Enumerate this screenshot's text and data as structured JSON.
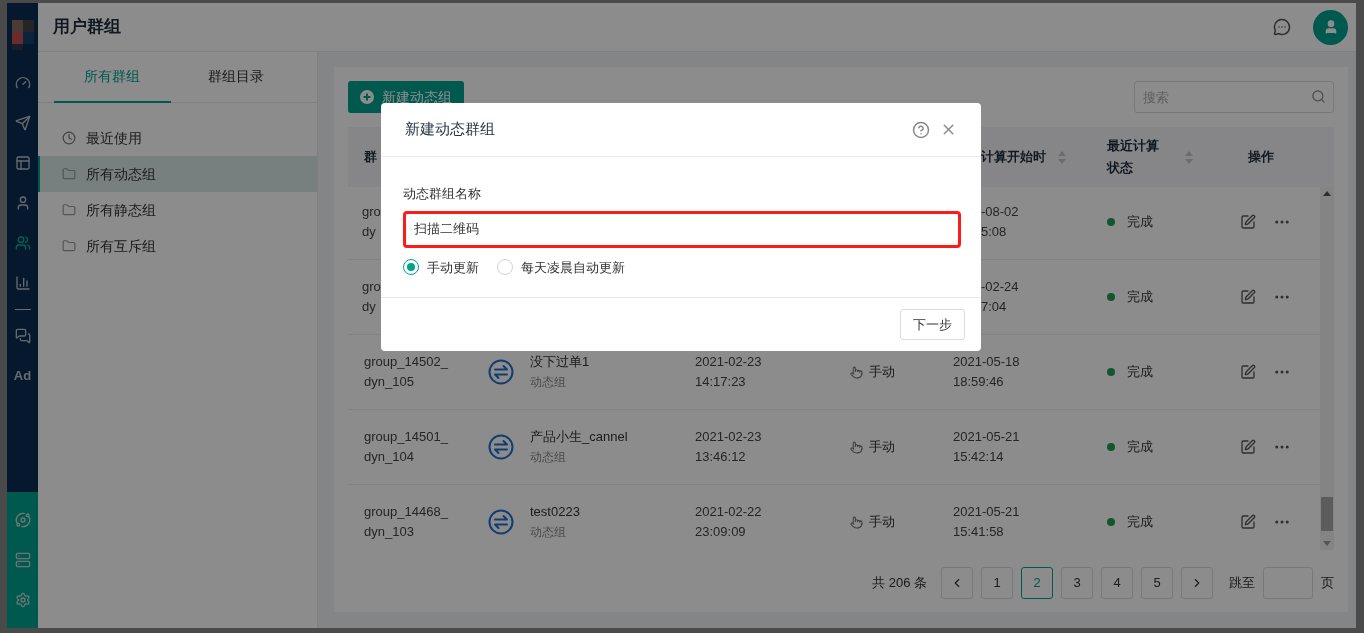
{
  "app_header": {
    "title": "用户群组"
  },
  "sidebar": {
    "nav": [
      {
        "selected": false
      },
      {
        "selected": false
      },
      {
        "selected": false
      },
      {
        "selected": false
      },
      {
        "selected": true
      },
      {
        "selected": false
      },
      {
        "selected": false
      },
      {
        "label": "Ad",
        "selected": false
      }
    ],
    "bottom": [
      {
        "selected": false
      },
      {
        "selected": false
      },
      {
        "selected": false
      }
    ]
  },
  "left_panel": {
    "tabs": [
      {
        "label": "所有群组",
        "selected": true
      },
      {
        "label": "群组目录",
        "selected": false
      }
    ],
    "items": [
      {
        "kind": "recent",
        "label": "最近使用",
        "selected": false
      },
      {
        "kind": "folder",
        "label": "所有动态组",
        "selected": true
      },
      {
        "kind": "folder",
        "label": "所有静态组",
        "selected": false
      },
      {
        "kind": "folder",
        "label": "所有互斥组",
        "selected": false
      }
    ]
  },
  "toolbar": {
    "new_button": "新建动态组",
    "search": {
      "placeholder": "搜索"
    }
  },
  "table": {
    "columns": [
      {
        "label": "群",
        "sortable": false
      },
      {
        "label": "计算开始时",
        "sortable": true
      },
      {
        "label": "最近计算状态",
        "sortable": true
      },
      {
        "label": "操作",
        "sortable": false
      }
    ],
    "rows": [
      {
        "kind": "partial",
        "group_id": [
          "gro",
          "dy"
        ],
        "last_calc": [
          "-08-02",
          "5:08"
        ],
        "status": "完成"
      },
      {
        "kind": "partial",
        "group_id": [
          "gro",
          "dy"
        ],
        "last_calc": [
          "-02-24",
          "7:04"
        ],
        "status": "完成"
      },
      {
        "kind": "full",
        "group_id": [
          "group_14502_",
          "dyn_105"
        ],
        "name": "没下过单1",
        "type": "动态组",
        "created": [
          "2021-02-23",
          "14:17:23"
        ],
        "update_mode": "手动",
        "last_calc": [
          "2021-05-18",
          "18:59:46"
        ],
        "status": "完成"
      },
      {
        "kind": "full",
        "group_id": [
          "group_14501_",
          "dyn_104"
        ],
        "name": "产品小生_cannel",
        "type": "动态组",
        "created": [
          "2021-02-23",
          "13:46:12"
        ],
        "update_mode": "手动",
        "last_calc": [
          "2021-05-21",
          "15:42:14"
        ],
        "status": "完成"
      },
      {
        "kind": "full",
        "group_id": [
          "group_14468_",
          "dyn_103"
        ],
        "name": "test0223",
        "type": "动态组",
        "created": [
          "2021-02-22",
          "23:09:09"
        ],
        "update_mode": "手动",
        "last_calc": [
          "2021-05-21",
          "15:41:58"
        ],
        "status": "完成"
      }
    ]
  },
  "pagination": {
    "total": "共 206 条",
    "pages": [
      {
        "label": "1",
        "selected": false
      },
      {
        "label": "2",
        "selected": true
      },
      {
        "label": "3",
        "selected": false
      },
      {
        "label": "4",
        "selected": false
      },
      {
        "label": "5",
        "selected": false
      }
    ],
    "jump_label": "跳至",
    "page_suffix": "页"
  },
  "dialog": {
    "title": "新建动态群组",
    "field_label": "动态群组名称",
    "name_field": {
      "value": "扫描二维码",
      "highlighted": true
    },
    "update_options": [
      {
        "label": "手动更新",
        "selected": true
      },
      {
        "label": "每天凌晨自动更新",
        "selected": false
      }
    ],
    "next_button": "下一步"
  }
}
